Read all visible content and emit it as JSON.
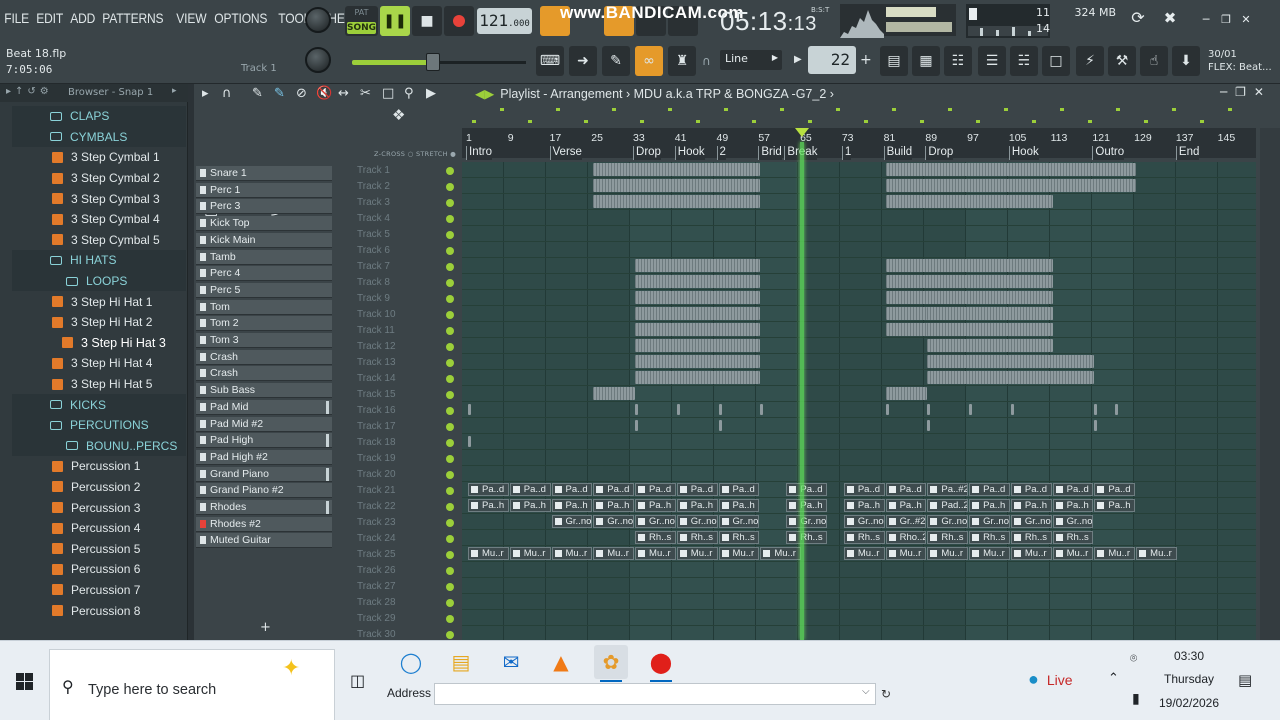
{
  "menu": [
    "FILE",
    "EDIT",
    "ADD",
    "PATTERNS",
    "VIEW",
    "OPTIONS",
    "TOOLS",
    "HELP"
  ],
  "project": {
    "name": "Beat 18.flp",
    "time": "7:05:06",
    "track_label": "Track 1"
  },
  "transport": {
    "pat_label": "PAT",
    "song_label": "SONG",
    "tempo": "121",
    "tempo_fraction": ".000"
  },
  "recorder_watermark": "www.BANDICAM.com",
  "clock": {
    "time": "05:13",
    "ticks": ":13",
    "unit": "B:S:T"
  },
  "system": {
    "memory": "324 MB",
    "polyphony_a": "11",
    "polyphony_b": "14"
  },
  "toolbar2": {
    "snap": "Line",
    "step": "22",
    "flex_line1": "30/01",
    "flex_line2": "FLEX: Beat..."
  },
  "browser": {
    "header": "Browser - Snap 1",
    "items": [
      {
        "label": "CLAPS",
        "type": "folder"
      },
      {
        "label": "CYMBALS",
        "type": "folder"
      },
      {
        "label": "3 Step Cymbal 1",
        "type": "file"
      },
      {
        "label": "3 Step Cymbal 2",
        "type": "file"
      },
      {
        "label": "3 Step Cymbal 3",
        "type": "file"
      },
      {
        "label": "3 Step Cymbal 4",
        "type": "file"
      },
      {
        "label": "3 Step Cymbal 5",
        "type": "file"
      },
      {
        "label": "HI HATS",
        "type": "folder"
      },
      {
        "label": "LOOPS",
        "type": "folder"
      },
      {
        "label": "3 Step Hi Hat 1",
        "type": "file"
      },
      {
        "label": "3 Step Hi Hat 2",
        "type": "file"
      },
      {
        "label": "3 Step Hi Hat 3",
        "type": "file",
        "active": true
      },
      {
        "label": "3 Step Hi Hat 4",
        "type": "file"
      },
      {
        "label": "3 Step Hi Hat 5",
        "type": "file"
      },
      {
        "label": "KICKS",
        "type": "folder"
      },
      {
        "label": "PERCUTIONS",
        "type": "folder"
      },
      {
        "label": "BOUNU..PERCS",
        "type": "folder"
      },
      {
        "label": "Percussion 1",
        "type": "file"
      },
      {
        "label": "Percussion 2",
        "type": "file"
      },
      {
        "label": "Percussion 3",
        "type": "file"
      },
      {
        "label": "Percussion 4",
        "type": "file"
      },
      {
        "label": "Percussion 5",
        "type": "file"
      },
      {
        "label": "Percussion 6",
        "type": "file"
      },
      {
        "label": "Percussion 7",
        "type": "file"
      },
      {
        "label": "Percussion 8",
        "type": "file"
      }
    ]
  },
  "playlist": {
    "title": "Playlist - Arrangement",
    "pattern_crumb": "MDU a.k.a TRP & BONGZA -G7_2",
    "zcross": "Z-CROSS",
    "stretch": "STRETCH",
    "patterns": [
      "Snare 1",
      "Perc 1",
      "Perc 3",
      "Kick Top",
      "Kick Main",
      "Tamb",
      "Perc 4",
      "Perc 5",
      "Tom",
      "Tom 2",
      "Tom 3",
      "Crash",
      "Crash",
      "Sub Bass",
      "Pad Mid",
      "Pad Mid  #2",
      "Pad High",
      "Pad High  #2",
      "Grand Piano",
      "Grand Piano #2",
      "Rhodes",
      "Rhodes  #2",
      "Muted Guitar"
    ],
    "tracks": [
      "Track 1",
      "Track 2",
      "Track 3",
      "Track 4",
      "Track 5",
      "Track 6",
      "Track 7",
      "Track 8",
      "Track 9",
      "Track 10",
      "Track 11",
      "Track 12",
      "Track 13",
      "Track 14",
      "Track 15",
      "Track 16",
      "Track 17",
      "Track 18",
      "Track 19",
      "Track 20",
      "Track 21",
      "Track 22",
      "Track 23",
      "Track 24",
      "Track 25",
      "Track 26",
      "Track 27",
      "Track 28",
      "Track 29",
      "Track 30"
    ],
    "bar_numbers": [
      "1",
      "9",
      "17",
      "25",
      "33",
      "41",
      "49",
      "57",
      "65",
      "73",
      "81",
      "89",
      "97",
      "105",
      "113",
      "121",
      "129",
      "137",
      "145"
    ],
    "markers": [
      {
        "label": "Intro",
        "bar": 1
      },
      {
        "label": "Verse",
        "bar": 17
      },
      {
        "label": "Drop",
        "bar": 33
      },
      {
        "label": "Hook",
        "bar": 41
      },
      {
        "label": "2",
        "bar": 49
      },
      {
        "label": "Brid",
        "bar": 57
      },
      {
        "label": "Break",
        "bar": 62
      },
      {
        "label": "1",
        "bar": 73
      },
      {
        "label": "Build",
        "bar": 81
      },
      {
        "label": "Drop",
        "bar": 89
      },
      {
        "label": "Hook",
        "bar": 105
      },
      {
        "label": "Outro",
        "bar": 121
      },
      {
        "label": "End",
        "bar": 137
      }
    ],
    "playhead_bar": 65,
    "audio_rows": {
      "21": [
        "Pa..d",
        "Pa..d",
        "Pa..d",
        "Pa..d",
        "Pa..d",
        "Pa..d",
        "Pa..d",
        "Pa..d",
        "Pa..d",
        "Pa..d",
        "Pa..#2",
        "Pa..d",
        "Pa..d",
        "Pa..d",
        "Pa..d"
      ],
      "22": [
        "Pa..h",
        "Pa..h",
        "Pa..h",
        "Pa..h",
        "Pa..h",
        "Pa..h",
        "Pa..h",
        "Pa..h",
        "Pa..h",
        "Pa..h",
        "Pad..2",
        "Pa..h",
        "Pa..h",
        "Pa..h",
        "Pa..h"
      ],
      "23": [
        "Gr..no",
        "Gr..no",
        "Gr..no",
        "Gr..no",
        "Gr..no",
        "Gr..no",
        "Gr..no",
        "Gr..#2",
        "Gr..no",
        "Gr..no",
        "Gr..no",
        "Gr..no"
      ],
      "24": [
        "Rh..s",
        "Rh..s",
        "Rh..s",
        "Rh..s",
        "Rh..s",
        "Rho..2",
        "Rh..s",
        "Rh..s",
        "Rh..s",
        "Rh..s"
      ],
      "25": [
        "Mu..r",
        "Mu..r",
        "Mu..r",
        "Mu..r",
        "Mu..r",
        "Mu..r",
        "Mu..r",
        "Mu..r",
        "Mu..r",
        "Mu..r",
        "Mu..r",
        "Mu..r",
        "Mu..r",
        "Mu..r",
        "Mu..r",
        "Mu..r"
      ]
    }
  },
  "taskbar": {
    "search_placeholder": "Type here to search",
    "address_label": "Address",
    "live_label": "Live",
    "time": "03:30",
    "day": "Thursday",
    "date": "19/02/2026"
  }
}
